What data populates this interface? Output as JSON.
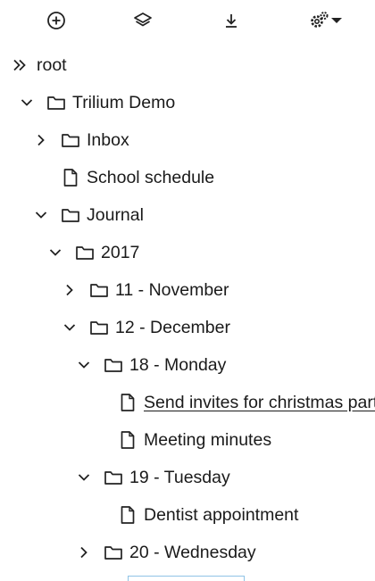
{
  "toolbar": {
    "buttons": [
      {
        "name": "create-root-note-button",
        "icon": "plus-circle-icon"
      },
      {
        "name": "collapse-tree-button",
        "icon": "layers-icon"
      },
      {
        "name": "scroll-to-active-button",
        "icon": "download-arrow-icon"
      },
      {
        "name": "tree-settings-button",
        "icon": "gears-dropdown-icon"
      }
    ]
  },
  "tree": {
    "root_label": "root",
    "items": [
      {
        "label": "Trilium Demo",
        "level": 1,
        "type": "folder",
        "expander": "expanded"
      },
      {
        "label": "Inbox",
        "level": 2,
        "type": "folder",
        "expander": "collapsed"
      },
      {
        "label": "School schedule",
        "level": 2,
        "type": "note",
        "expander": "none"
      },
      {
        "label": "Journal",
        "level": 2,
        "type": "folder",
        "expander": "expanded"
      },
      {
        "label": "2017",
        "level": 3,
        "type": "folder",
        "expander": "expanded"
      },
      {
        "label": "11 - November",
        "level": 4,
        "type": "folder",
        "expander": "collapsed"
      },
      {
        "label": "12 - December",
        "level": 4,
        "type": "folder",
        "expander": "expanded"
      },
      {
        "label": "18 - Monday",
        "level": 5,
        "type": "folder",
        "expander": "expanded"
      },
      {
        "label": "Send invites for christmas party",
        "level": 6,
        "type": "note",
        "expander": "none",
        "active": true
      },
      {
        "label": "Meeting minutes",
        "level": 6,
        "type": "note",
        "expander": "none"
      },
      {
        "label": "19 - Tuesday",
        "level": 5,
        "type": "folder",
        "expander": "expanded"
      },
      {
        "label": "Dentist appointment",
        "level": 6,
        "type": "note",
        "expander": "none"
      },
      {
        "label": "20 - Wednesday",
        "level": 5,
        "type": "folder",
        "expander": "collapsed"
      }
    ]
  },
  "colors": {
    "text": "#1a1a1a",
    "icon": "#222222",
    "drop_indicator": "#8fc3e6"
  }
}
